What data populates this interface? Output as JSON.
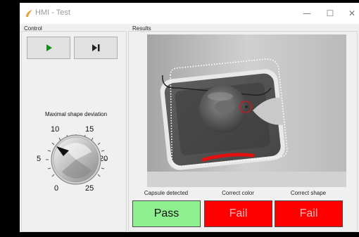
{
  "window": {
    "title": "HMI - Test",
    "controls": {
      "minimize": "—",
      "maximize": "☐",
      "close": "✕"
    }
  },
  "control": {
    "group_label": "Control",
    "play_icon": "play-icon",
    "step_icon": "step-forward-icon"
  },
  "knob": {
    "label": "Maximal shape deviation",
    "ticks": [
      "0",
      "5",
      "10",
      "15",
      "20",
      "25"
    ],
    "value": 10
  },
  "results": {
    "group_label": "Results",
    "items": [
      {
        "label": "Capsule detected",
        "status": "Pass",
        "color": "#8ff08f"
      },
      {
        "label": "Correct color",
        "status": "Fail",
        "color": "#ff0000"
      },
      {
        "label": "Correct shape",
        "status": "Fail",
        "color": "#ff0000"
      }
    ]
  },
  "colors": {
    "accent_icon": "#e8a23a",
    "play_green": "#1a8c1a",
    "pass": "#8ff08f",
    "fail": "#ff0000"
  }
}
